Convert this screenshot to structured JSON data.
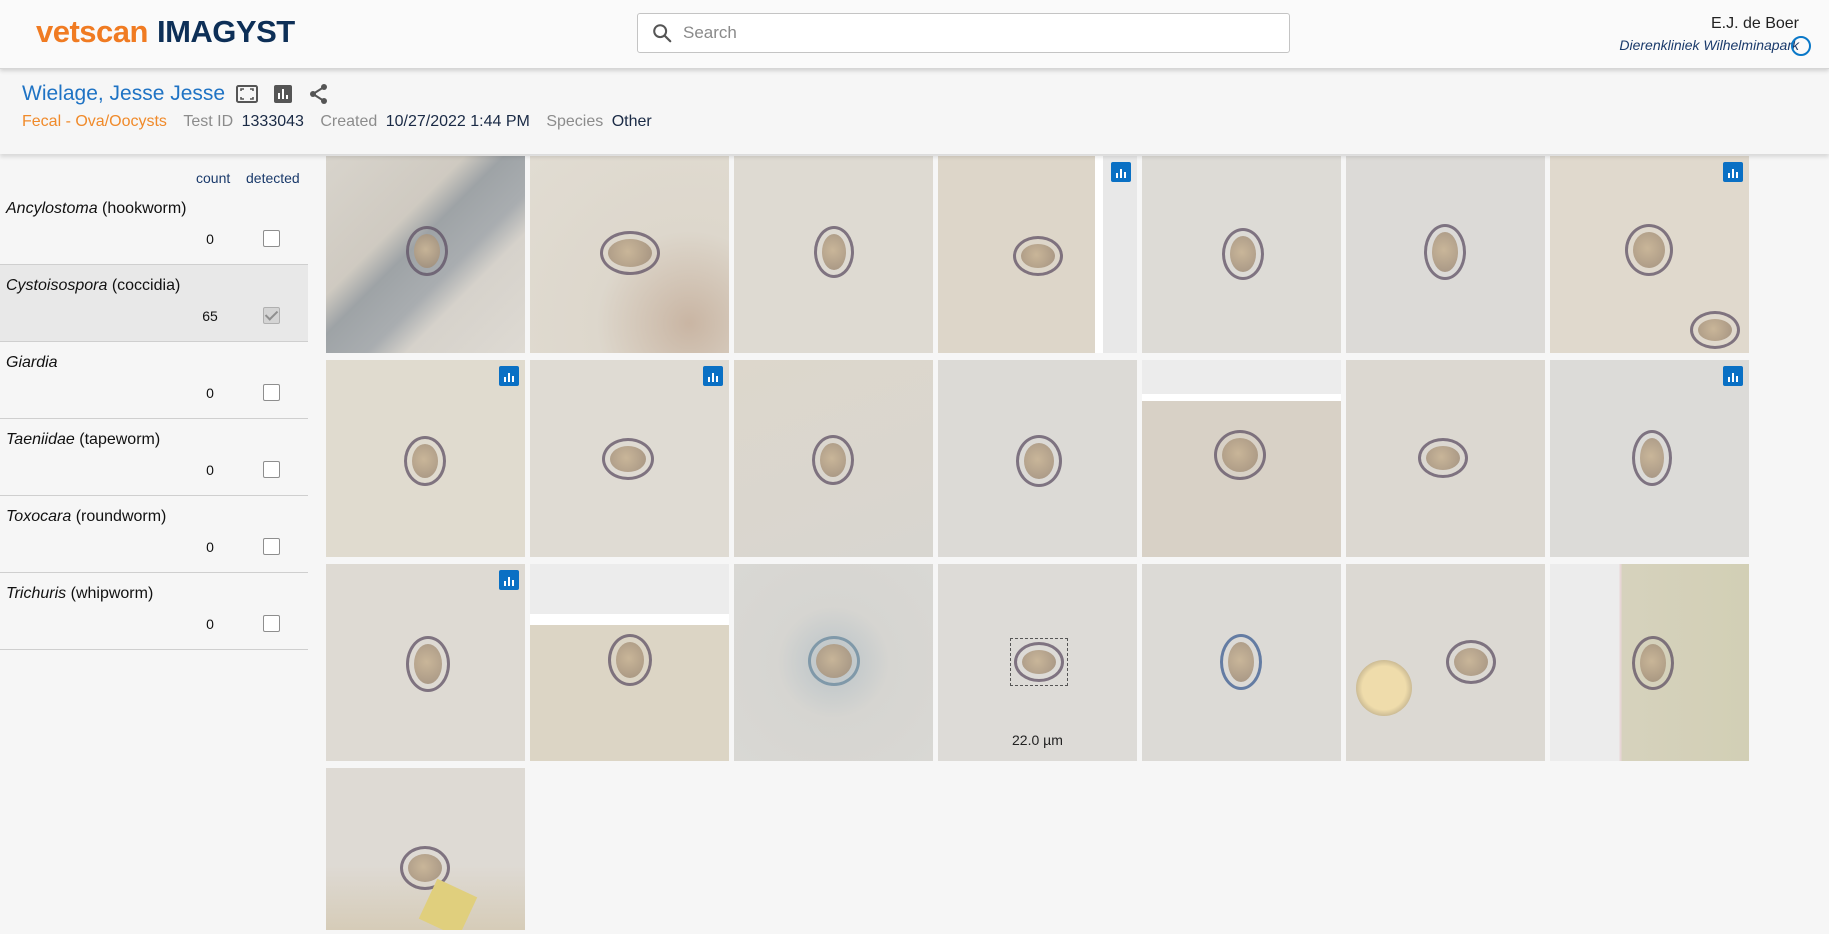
{
  "header": {
    "logo_part1": "vetscan",
    "logo_part2": "IMAGYST",
    "search_placeholder": "Search",
    "user_name": "E.J. de Boer",
    "clinic": "Dierenkliniek Wilhelminapark"
  },
  "patient": {
    "name": "Wielage, Jesse Jesse",
    "test_type": "Fecal - Ova/Oocysts",
    "test_id_label": "Test ID",
    "test_id": "1333043",
    "created_label": "Created",
    "created": "10/27/2022 1:44 PM",
    "species_label": "Species",
    "species": "Other"
  },
  "sidebar": {
    "count_header": "count",
    "detected_header": "detected",
    "parasites": [
      {
        "genus": "Ancylostoma",
        "common": "(hookworm)",
        "count": "0",
        "detected": false
      },
      {
        "genus": "Cystoisospora",
        "common": "(coccidia)",
        "count": "65",
        "detected": true
      },
      {
        "genus": "Giardia",
        "common": "",
        "count": "0",
        "detected": false
      },
      {
        "genus": "Taeniidae",
        "common": "(tapeworm)",
        "count": "0",
        "detected": false
      },
      {
        "genus": "Toxocara",
        "common": "(roundworm)",
        "count": "0",
        "detected": false
      },
      {
        "genus": "Trichuris",
        "common": "(whipworm)",
        "count": "0",
        "detected": false
      }
    ]
  },
  "gallery": {
    "measurement_label": "22.0 µm",
    "colors": {
      "brand_orange": "#f07b22",
      "brand_navy": "#0d2f57",
      "link_blue": "#1f73c4",
      "badge_blue": "#0a70c4"
    }
  }
}
